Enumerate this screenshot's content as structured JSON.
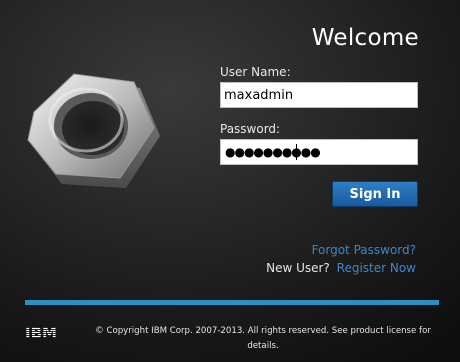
{
  "login": {
    "welcome": "Welcome",
    "username_label": "User Name:",
    "username_value": "maxadmin",
    "password_label": "Password:",
    "password_value": "●●●●●●●●●●",
    "signin_label": "Sign In",
    "forgot_link": "Forgot Password?",
    "new_user_text": "New User?",
    "register_link": "Register Now"
  },
  "footer": {
    "brand": "IBM",
    "copyright": "© Copyright IBM Corp. 2007-2013. All rights reserved. See product license for details."
  },
  "colors": {
    "accent": "#2b8ec6",
    "link": "#3e86c9",
    "button": "#195a9e"
  }
}
